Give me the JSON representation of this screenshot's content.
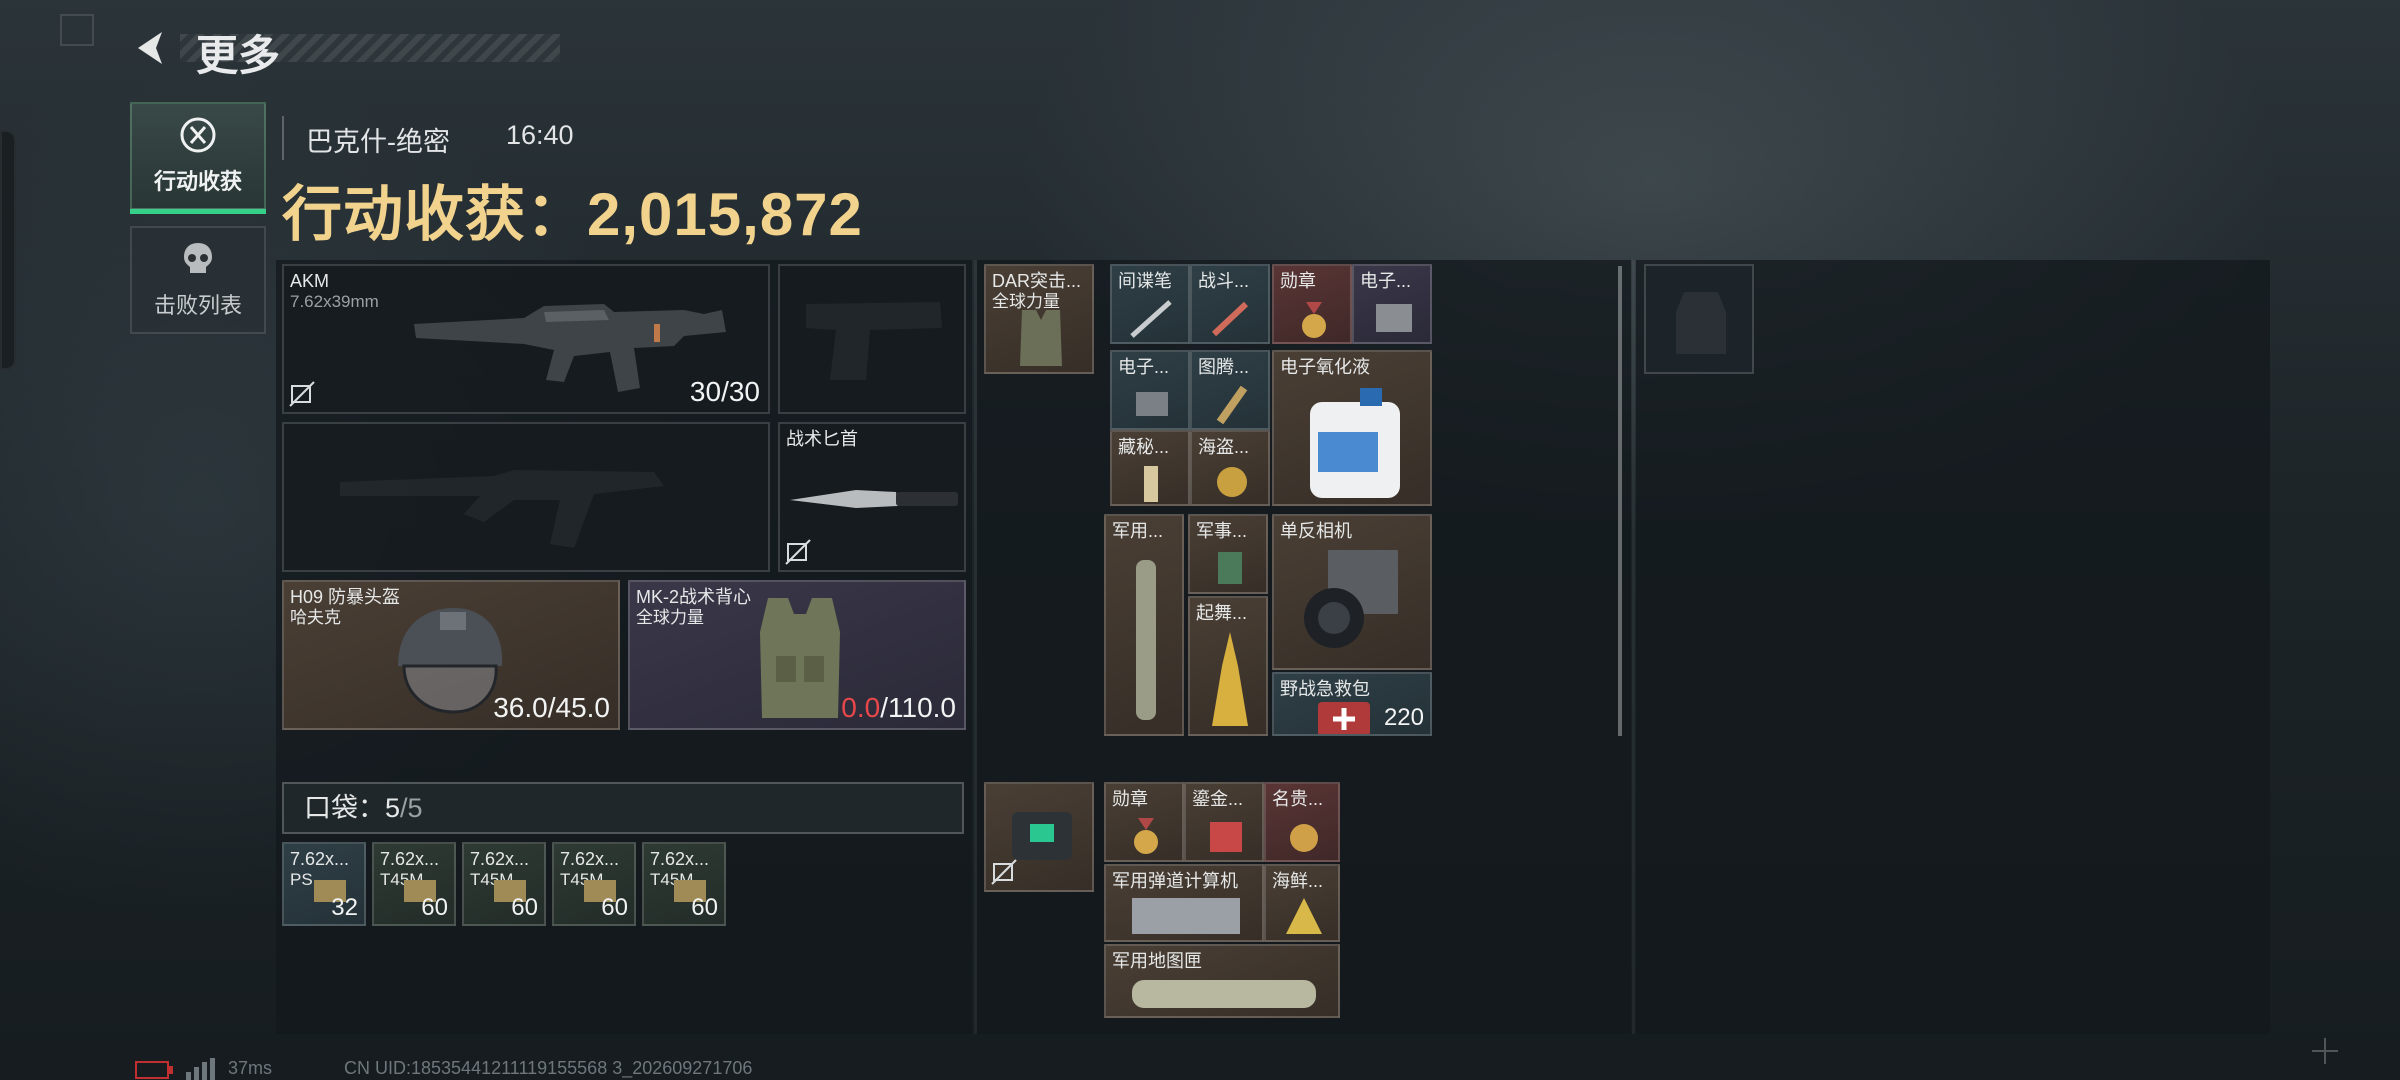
{
  "header": {
    "title": "更多"
  },
  "tabs": [
    {
      "label": "行动收获",
      "icon": "target-icon",
      "active": true
    },
    {
      "label": "击败列表",
      "icon": "skull-icon",
      "active": false
    }
  ],
  "raid": {
    "map": "巴克什-绝密",
    "time": "16:40",
    "gain_label": "行动收获：",
    "gain_value": "2,015,872"
  },
  "equipment": {
    "primary": {
      "name": "AKM",
      "ammo": "7.62x39mm",
      "count": "30/30"
    },
    "secondary_empty": true,
    "melee": {
      "name": "战术匕首"
    },
    "helmet": {
      "name": "H09 防暴头盔",
      "sub": "哈夫克",
      "durability": "36.0",
      "max": "/45.0"
    },
    "armor": {
      "name": "MK-2战术背心",
      "sub": "全球力量",
      "durability": "0.0",
      "max": "/110.0"
    },
    "chest_rig": {
      "name": "DAR突击...",
      "sub": "全球力量"
    }
  },
  "pocket": {
    "label": "口袋：",
    "count": "5",
    "capacity": "/5",
    "items": [
      {
        "name": "7.62x...",
        "sub": "PS",
        "count": "32"
      },
      {
        "name": "7.62x...",
        "sub": "T45M",
        "count": "60"
      },
      {
        "name": "7.62x...",
        "sub": "T45M",
        "count": "60"
      },
      {
        "name": "7.62x...",
        "sub": "T45M",
        "count": "60"
      },
      {
        "name": "7.62x...",
        "sub": "T45M",
        "count": "60"
      }
    ]
  },
  "rig_items": [
    "间谍笔",
    "战斗...",
    "勋章",
    "电子...",
    "电子...",
    "图腾...",
    "电子氧化液",
    "藏秘..."
  ],
  "rig_items2": [
    "海盗...",
    "军用...",
    "军事...",
    "单反相机",
    "起舞...",
    "野战急救包"
  ],
  "rig_counts": {
    "medkit": "220"
  },
  "case_items": [
    "勋章",
    "鎏金...",
    "名贵...",
    "军用弹道计算机",
    "海鲜...",
    "军用地图匣"
  ],
  "footer": {
    "ping": "37ms",
    "uid": "CN UID:18535441211119155568 3_202609271706"
  }
}
